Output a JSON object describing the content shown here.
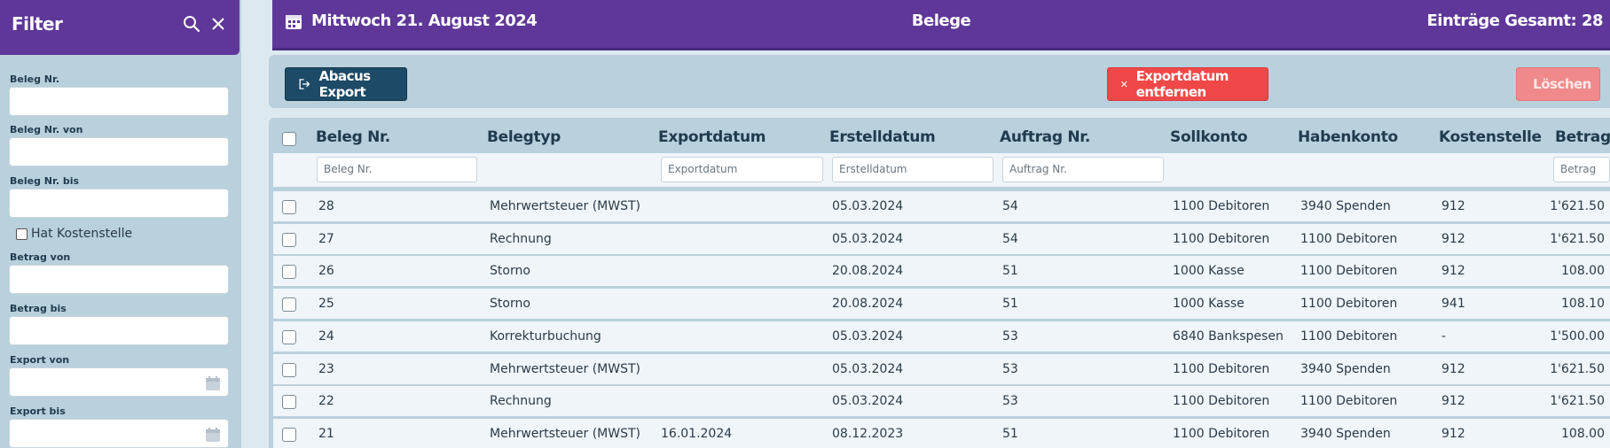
{
  "sidebar": {
    "title": "Filter",
    "fields": [
      {
        "label": "Beleg Nr.",
        "value": ""
      },
      {
        "label": "Beleg Nr. von",
        "value": ""
      },
      {
        "label": "Beleg Nr. bis",
        "value": ""
      },
      {
        "label": "Betrag von",
        "value": ""
      },
      {
        "label": "Betrag bis",
        "value": ""
      },
      {
        "label": "Export von",
        "value": ""
      },
      {
        "label": "Export bis",
        "value": ""
      }
    ],
    "checkbox_label": "Hat Kostenstelle"
  },
  "header": {
    "date": "Mittwoch 21. August 2024",
    "title": "Belege",
    "total": "Einträge Gesamt: 28"
  },
  "toolbar": {
    "abacus_label": "Abacus Export",
    "remove_export_label": "Exportdatum entfernen",
    "delete_label": "Löschen"
  },
  "table": {
    "columns": [
      "Beleg Nr.",
      "Belegtyp",
      "Exportdatum",
      "Erstelldatum",
      "Auftrag Nr.",
      "Sollkonto",
      "Habenkonto",
      "Kostenstelle",
      "Betrag"
    ],
    "filter_placeholders": {
      "beleg_nr": "Beleg Nr.",
      "exportdatum": "Exportdatum",
      "erstelldatum": "Erstelldatum",
      "auftrag_nr": "Auftrag Nr.",
      "betrag": "Betrag"
    },
    "rows": [
      {
        "nr": "28",
        "typ": "Mehrwertsteuer (MWST)",
        "export": "",
        "erstell": "05.03.2024",
        "auftrag": "54",
        "soll": "1100 Debitoren",
        "haben": "3940 Spenden",
        "kst": "912",
        "betrag": "1'621.50"
      },
      {
        "nr": "27",
        "typ": "Rechnung",
        "export": "",
        "erstell": "05.03.2024",
        "auftrag": "54",
        "soll": "1100 Debitoren",
        "haben": "1100 Debitoren",
        "kst": "912",
        "betrag": "1'621.50"
      },
      {
        "nr": "26",
        "typ": "Storno",
        "export": "",
        "erstell": "20.08.2024",
        "auftrag": "51",
        "soll": "1000 Kasse",
        "haben": "1100 Debitoren",
        "kst": "912",
        "betrag": "108.00"
      },
      {
        "nr": "25",
        "typ": "Storno",
        "export": "",
        "erstell": "20.08.2024",
        "auftrag": "51",
        "soll": "1000 Kasse",
        "haben": "1100 Debitoren",
        "kst": "941",
        "betrag": "108.10"
      },
      {
        "nr": "24",
        "typ": "Korrekturbuchung",
        "export": "",
        "erstell": "05.03.2024",
        "auftrag": "53",
        "soll": "6840 Bankspesen",
        "haben": "1100 Debitoren",
        "kst": "-",
        "betrag": "1'500.00"
      },
      {
        "nr": "23",
        "typ": "Mehrwertsteuer (MWST)",
        "export": "",
        "erstell": "05.03.2024",
        "auftrag": "53",
        "soll": "1100 Debitoren",
        "haben": "3940 Spenden",
        "kst": "912",
        "betrag": "1'621.50"
      },
      {
        "nr": "22",
        "typ": "Rechnung",
        "export": "",
        "erstell": "05.03.2024",
        "auftrag": "53",
        "soll": "1100 Debitoren",
        "haben": "1100 Debitoren",
        "kst": "912",
        "betrag": "1'621.50"
      },
      {
        "nr": "21",
        "typ": "Mehrwertsteuer (MWST)",
        "export": "16.01.2024",
        "erstell": "08.12.2023",
        "auftrag": "51",
        "soll": "1100 Debitoren",
        "haben": "3940 Spenden",
        "kst": "912",
        "betrag": "108.00"
      }
    ]
  }
}
